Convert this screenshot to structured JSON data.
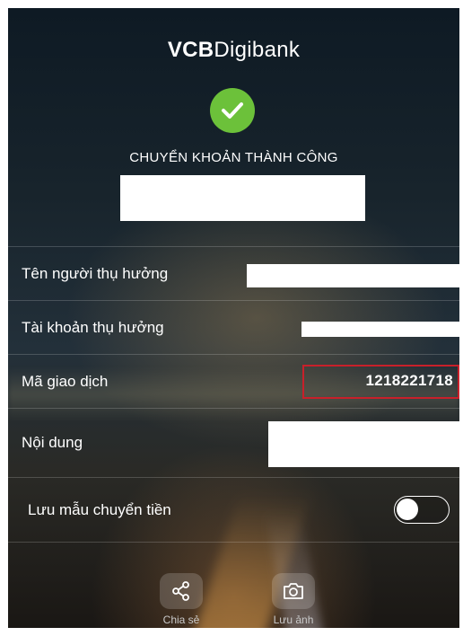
{
  "brand": {
    "part1": "VCB",
    "part2": "Digibank"
  },
  "status_text": "CHUYỂN KHOẢN THÀNH CÔNG",
  "details": [
    {
      "label": "Tên người thụ hưởng"
    },
    {
      "label": "Tài khoản thụ hưởng"
    },
    {
      "label": "Mã giao dịch",
      "value": "1218221718"
    },
    {
      "label": "Nội dung"
    }
  ],
  "save_template": {
    "label": "Lưu mẫu chuyển tiền",
    "enabled": false
  },
  "actions": [
    {
      "label": "Chia sẻ",
      "icon": "share-icon"
    },
    {
      "label": "Lưu ảnh",
      "icon": "camera-icon"
    }
  ],
  "colors": {
    "success": "#6cc13a",
    "highlight": "#c8202a"
  }
}
